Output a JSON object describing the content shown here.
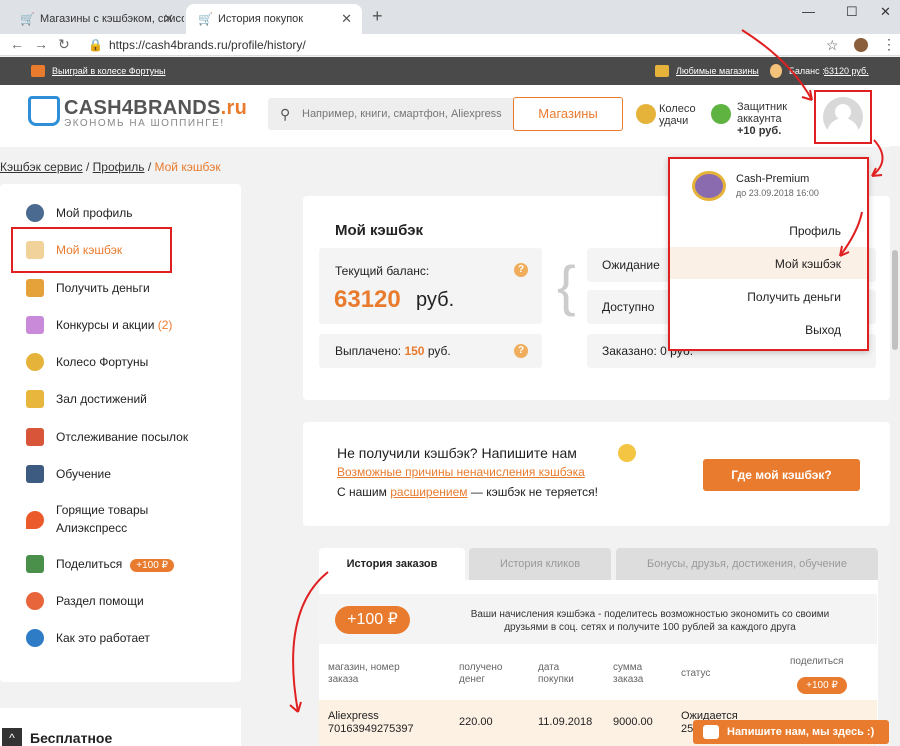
{
  "browser": {
    "tabs": [
      {
        "title": "Магазины с кэшбэком, список с",
        "active": false
      },
      {
        "title": "История покупок",
        "active": true
      }
    ],
    "url": "https://cash4brands.ru/profile/history/"
  },
  "topstrip": {
    "wheel_link": "Выиграй в колесе Фортуны",
    "fav_shops_link": "Любимые магазины",
    "balance_label": "Баланс :",
    "balance_value": "63120 руб."
  },
  "header": {
    "logo_main": "CASH4BRANDS",
    "logo_suffix": ".ru",
    "logo_tagline": "ЭКОНОМЬ НА ШОППИНГЕ!",
    "search_placeholder": "Например, книги, смартфон, Aliexpress",
    "shops_button": "Магазины",
    "luck_wheel_line1": "Колесо",
    "luck_wheel_line2": "удачи",
    "protector_line1": "Защитник",
    "protector_line2": "аккаунта",
    "protector_bonus": "+10 руб."
  },
  "breadcrumb": {
    "home": "Кэшбэк сервис",
    "sep": "/",
    "profile": "Профиль",
    "current": "Мой кэшбэк"
  },
  "sidebar": {
    "items": [
      {
        "label": "Мой профиль"
      },
      {
        "label": "Мой кэшбэк"
      },
      {
        "label": "Получить деньги"
      },
      {
        "label": "Конкурсы и акции",
        "count": "(2)"
      },
      {
        "label": "Колесо Фортуны"
      },
      {
        "label": "Зал достижений"
      },
      {
        "label": "Отслеживание посылок"
      },
      {
        "label": "Обучение"
      },
      {
        "label": "Горящие товары",
        "label2": "Алиэкспресс"
      },
      {
        "label": "Поделиться",
        "badge": "+100 ₽"
      },
      {
        "label": "Раздел помощи"
      },
      {
        "label": "Как это работает"
      }
    ],
    "promo_title": "Бесплатное"
  },
  "cashback": {
    "title": "Мой кэшбэк",
    "current_balance_label": "Текущий баланс:",
    "current_balance_value": "63120",
    "currency": "руб.",
    "paid_label": "Выплачено:",
    "paid_value": "150",
    "pending_label": "Ожидание",
    "available_label": "Доступно",
    "ordered_label": "Заказано:",
    "ordered_value": "0 руб."
  },
  "not_received": {
    "title": "Не получили кэшбэк? Напишите нам",
    "reasons_link": "Возможные причины неначисления кэшбэка",
    "ext_prefix": "С нашим",
    "ext_link": "расширением",
    "ext_suffix": "— кэшбэк не теряется!",
    "where_button": "Где мой кэшбэк?"
  },
  "history_tabs": [
    {
      "label": "История заказов",
      "active": true
    },
    {
      "label": "История кликов",
      "active": false
    },
    {
      "label": "Бонусы, друзья, достижения, обучение",
      "active": false
    }
  ],
  "share_banner": {
    "badge": "+100 ₽",
    "text_line1": "Ваши начисления кэшбэка - поделитесь возможностью экономить со своими",
    "text_line2": "друзьями в соц. сетях и получите 100 рублей за каждого друга"
  },
  "orders_table": {
    "columns": {
      "shop_line1": "магазин, номер",
      "shop_line2": "заказа",
      "received_line1": "получено",
      "received_line2": "денег",
      "date_line1": "дата",
      "date_line2": "покупки",
      "amount_line1": "сумма",
      "amount_line2": "заказа",
      "status": "статус",
      "share": "поделиться",
      "share_badge": "+100 ₽"
    },
    "rows": [
      {
        "shop": "Aliexpress",
        "order": "70163949275397",
        "received": "220.00",
        "date": "11.09.2018",
        "amount": "9000.00",
        "status": "Ожидается",
        "status2": "25"
      }
    ]
  },
  "dropdown": {
    "tier": "Cash-Premium",
    "until": "до 23.09.2018 16:00",
    "items": [
      "Профиль",
      "Мой кэшбэк",
      "Получить деньги",
      "Выход"
    ]
  },
  "chat_button": "Напишите нам, мы здесь :)",
  "colors": {
    "accent": "#e97b2e",
    "annotation": "#e02020",
    "logo_blue": "#2e8fd6"
  }
}
